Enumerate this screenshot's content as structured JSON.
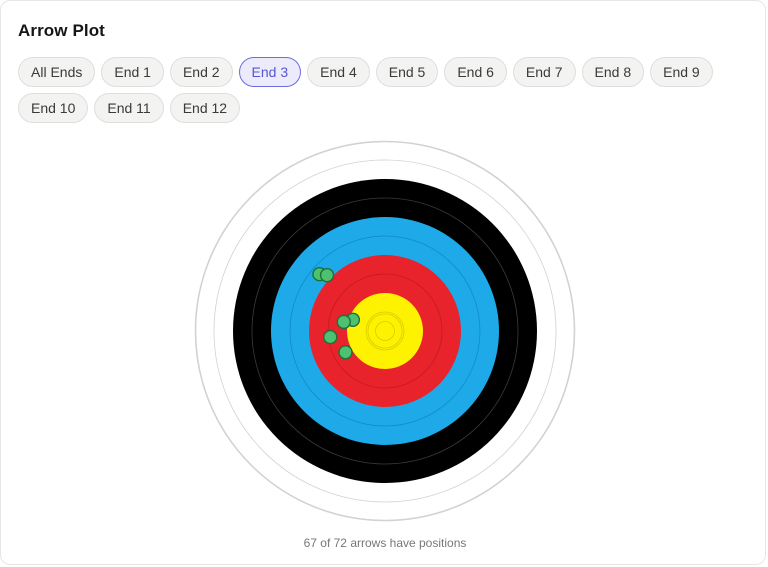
{
  "title": "Arrow Plot",
  "filters": [
    {
      "label": "All Ends",
      "active": false
    },
    {
      "label": "End 1",
      "active": false
    },
    {
      "label": "End 2",
      "active": false
    },
    {
      "label": "End 3",
      "active": true
    },
    {
      "label": "End 4",
      "active": false
    },
    {
      "label": "End 5",
      "active": false
    },
    {
      "label": "End 6",
      "active": false
    },
    {
      "label": "End 7",
      "active": false
    },
    {
      "label": "End 8",
      "active": false
    },
    {
      "label": "End 9",
      "active": false
    },
    {
      "label": "End 10",
      "active": false
    },
    {
      "label": "End 11",
      "active": false
    },
    {
      "label": "End 12",
      "active": false
    }
  ],
  "target": {
    "zones": [
      {
        "name": "white",
        "fill": "#ffffff",
        "ring_line": "#d2d2d2"
      },
      {
        "name": "black",
        "fill": "#000000",
        "ring_line": "#3a3a3a"
      },
      {
        "name": "blue",
        "fill": "#1ea9e8",
        "ring_line": "#0f8ccb"
      },
      {
        "name": "red",
        "fill": "#e8232b",
        "ring_line": "#c41a21"
      },
      {
        "name": "gold",
        "fill": "#fff200",
        "ring_line": "#d6cc00"
      }
    ],
    "arrow_color": "#4cc270",
    "arrow_stroke": "#1e6e38",
    "arrows": [
      {
        "x": -0.345,
        "y": 0.299
      },
      {
        "x": -0.305,
        "y": 0.294
      },
      {
        "x": -0.169,
        "y": 0.059
      },
      {
        "x": -0.217,
        "y": 0.048
      },
      {
        "x": -0.288,
        "y": -0.032
      },
      {
        "x": -0.208,
        "y": -0.112
      }
    ]
  },
  "footer": "67 of 72 arrows have positions"
}
